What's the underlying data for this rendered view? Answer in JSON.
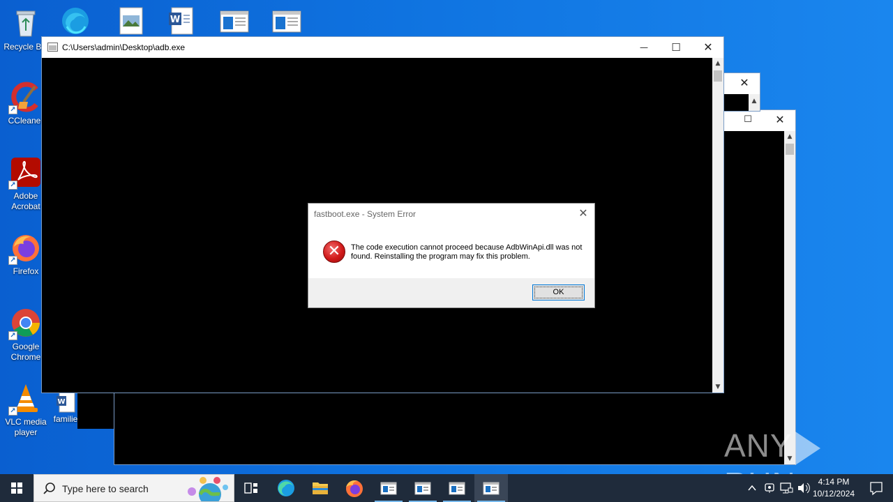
{
  "desktop": {
    "icons": [
      {
        "label": "Recycle Bin"
      },
      {
        "label": "CCleaner"
      },
      {
        "label": "Adobe Acrobat"
      },
      {
        "label": "Firefox"
      },
      {
        "label": "Google Chrome"
      },
      {
        "label": "VLC media player"
      },
      {
        "label": "familie"
      }
    ]
  },
  "main_window": {
    "title": "C:\\Users\\admin\\Desktop\\adb.exe",
    "minimize": "—",
    "maximize": "☐",
    "close": "✕"
  },
  "dialog": {
    "title": "fastboot.exe - System Error",
    "message": "The code execution cannot proceed because AdbWinApi.dll was not found. Reinstalling the program may fix this problem.",
    "ok_label": "OK",
    "close": "✕"
  },
  "watermark": {
    "left": "ANY",
    "right": "RUN"
  },
  "taskbar": {
    "search_placeholder": "Type here to search",
    "time": "4:14 PM",
    "date": "10/12/2024"
  },
  "colors": {
    "desktop_blue": "#0f73e0",
    "taskbar": "#1f2b3b",
    "error_red": "#d11a1a",
    "accent": "#0078d7"
  }
}
